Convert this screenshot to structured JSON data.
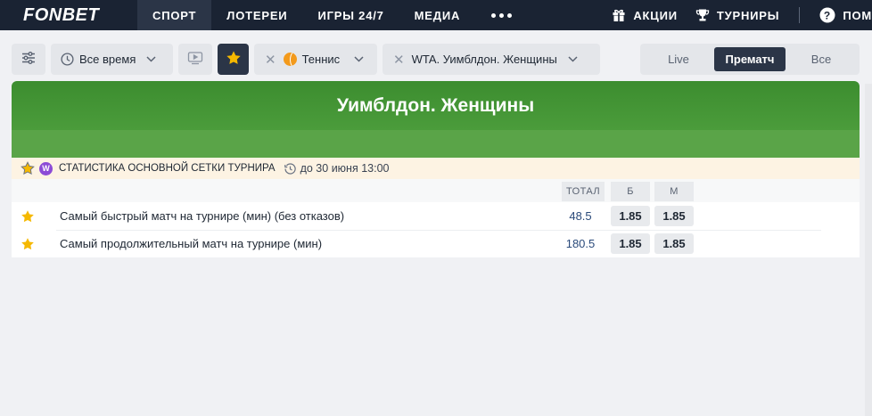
{
  "nav": {
    "logo": "FONBET",
    "items": [
      {
        "label": "СПОРТ",
        "active": true
      },
      {
        "label": "ЛОТЕРЕИ",
        "active": false
      },
      {
        "label": "ИГРЫ 24/7",
        "active": false
      },
      {
        "label": "МЕДИА",
        "active": false
      }
    ],
    "promo_label": "АКЦИИ",
    "tournaments_label": "ТУРНИРЫ",
    "help_label": "ПОМ"
  },
  "filters": {
    "period_label": "Все время",
    "sport_label": "Теннис",
    "league_label": "WTA. Уимблдон. Женщины"
  },
  "mode_tabs": [
    {
      "label": "Live",
      "active": false
    },
    {
      "label": "Прематч",
      "active": true
    },
    {
      "label": "Все",
      "active": false
    }
  ],
  "event": {
    "title": "Уимблдон. Женщины",
    "tournament_badge": "W",
    "tournament_name": "Статистика основной сетки турнира",
    "tournament_date": "до 30 июня 13:00",
    "columns": [
      "ТОТАЛ",
      "Б",
      "М"
    ],
    "rows": [
      {
        "name": "Самый быстрый матч на турнире (мин) (без отказов)",
        "total": "48.5",
        "over": "1.85",
        "under": "1.85"
      },
      {
        "name": "Самый продолжительный матч на турнире (мин)",
        "total": "180.5",
        "over": "1.85",
        "under": "1.85"
      }
    ]
  },
  "colors": {
    "nav_bg": "#1a2333",
    "active_dark": "#2b3547",
    "banner_green": "#4b9c3b",
    "star_yellow": "#f5b800",
    "badge_purple": "#8c4bd6"
  }
}
